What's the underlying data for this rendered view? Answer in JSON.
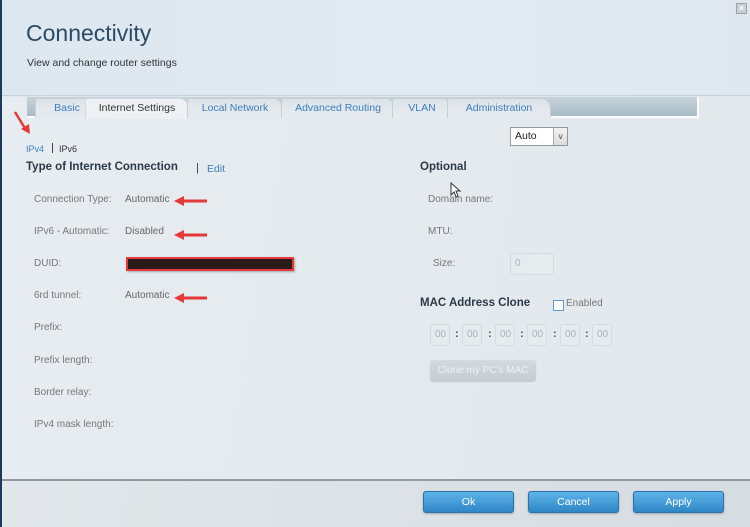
{
  "header": {
    "title": "Connectivity",
    "subtitle": "View and change router settings",
    "close_icon": "close-icon"
  },
  "tabs": [
    {
      "label": "Basic",
      "active": false
    },
    {
      "label": "Internet Settings",
      "active": true
    },
    {
      "label": "Local Network",
      "active": false
    },
    {
      "label": "Advanced Routing",
      "active": false
    },
    {
      "label": "VLAN",
      "active": false
    },
    {
      "label": "Administration",
      "active": false
    }
  ],
  "subtabs": {
    "ipv4": "IPv4",
    "ipv6": "IPv6",
    "active": "IPv4"
  },
  "connection": {
    "title": "Type of Internet Connection",
    "separator": "|",
    "edit_label": "Edit",
    "fields": [
      {
        "label": "Connection Type:",
        "value": "Automatic"
      },
      {
        "label": "IPv6 - Automatic:",
        "value": "Disabled"
      },
      {
        "label": "DUID:",
        "value": "[redacted]"
      },
      {
        "label": "6rd tunnel:",
        "value": "Automatic"
      },
      {
        "label": "Prefix:",
        "value": ""
      },
      {
        "label": "Prefix length:",
        "value": ""
      },
      {
        "label": "Border relay:",
        "value": ""
      },
      {
        "label": "IPv4 mask length:",
        "value": ""
      }
    ]
  },
  "optional": {
    "title": "Optional",
    "domain_label": "Domain name:",
    "mtu_label": "MTU:",
    "mtu_value": "Auto",
    "size_label": "Size:",
    "size_value": "0"
  },
  "mac_clone": {
    "title": "MAC Address Clone",
    "enabled_label": "Enabled",
    "enabled": false,
    "octets": [
      "00",
      "00",
      "00",
      "00",
      "00",
      "00"
    ],
    "separator": ":",
    "clone_button": "Clone my PC's MAC"
  },
  "footer": {
    "ok": "Ok",
    "cancel": "Cancel",
    "apply": "Apply"
  },
  "annotation_color": "#e63a3a"
}
